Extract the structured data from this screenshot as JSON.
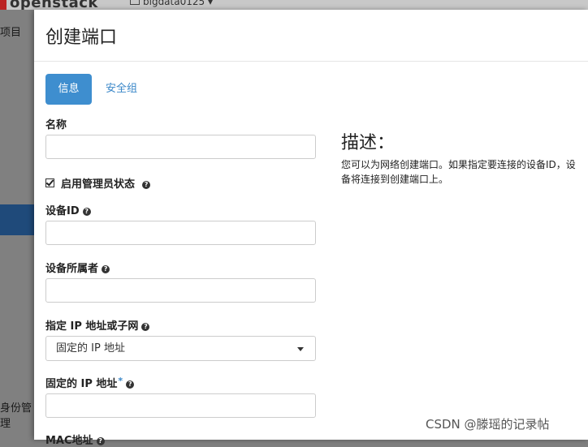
{
  "background": {
    "logo_text": "openstack",
    "project_label": "bigdata0125",
    "sidebar_items": [
      "项目",
      "身份管理"
    ]
  },
  "modal": {
    "title": "创建端口",
    "tabs": [
      {
        "label": "信息",
        "active": true
      },
      {
        "label": "安全组",
        "active": false
      }
    ],
    "fields": {
      "name": {
        "label": "名称",
        "value": ""
      },
      "admin_state": {
        "label": "启用管理员状态",
        "checked": true
      },
      "device_id": {
        "label": "设备ID",
        "value": ""
      },
      "device_owner": {
        "label": "设备所属者",
        "value": ""
      },
      "ip_or_subnet": {
        "label": "指定 IP 地址或子网",
        "selected": "固定的 IP 地址"
      },
      "fixed_ip": {
        "label": "固定的 IP 地址",
        "required_mark": "*",
        "value": ""
      },
      "mac": {
        "label": "MAC地址"
      }
    },
    "help_icon": "?",
    "description": {
      "title": "描述：",
      "line1": "您可以为网络创建端口。如果指定要连接的设备ID，设",
      "line2": "备将连接到创建端口上。"
    }
  },
  "watermark": "CSDN @滕瑶的记录帖",
  "colors": {
    "primary": "#3e8ecf",
    "link": "#3a87c8"
  }
}
